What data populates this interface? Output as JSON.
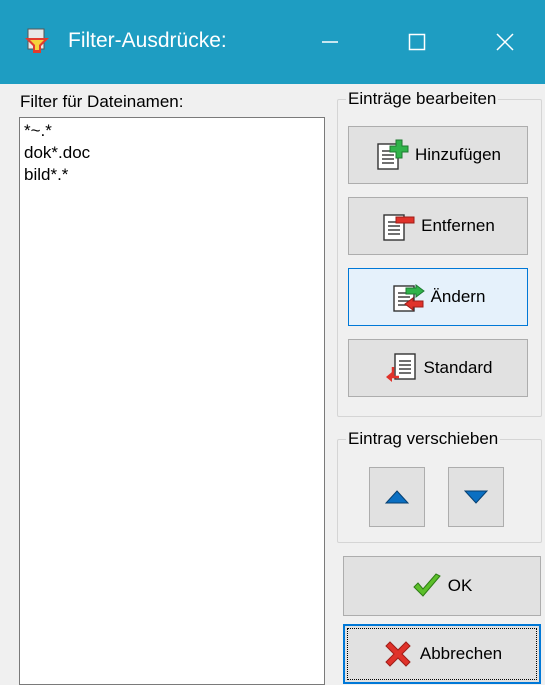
{
  "window": {
    "title": "Filter-Ausdrücke:",
    "minimize_glyph": "—",
    "maximize_glyph": "☐",
    "close_glyph": "✕"
  },
  "filters": {
    "label": "Filter für Dateinamen:",
    "items": [
      "*~.*",
      "dok*.doc",
      "bild*.*"
    ]
  },
  "edit_group": {
    "legend": "Einträge bearbeiten",
    "add_label": "Hinzufügen",
    "remove_label": "Entfernen",
    "change_label": "Ändern",
    "standard_label": "Standard"
  },
  "move_group": {
    "legend": "Eintrag verschieben"
  },
  "dialog": {
    "ok_label": "OK",
    "cancel_label": "Abbrechen"
  },
  "colors": {
    "titlebar": "#1e9dc2",
    "accent": "#0078d7",
    "arrow": "#0a6fc2"
  }
}
